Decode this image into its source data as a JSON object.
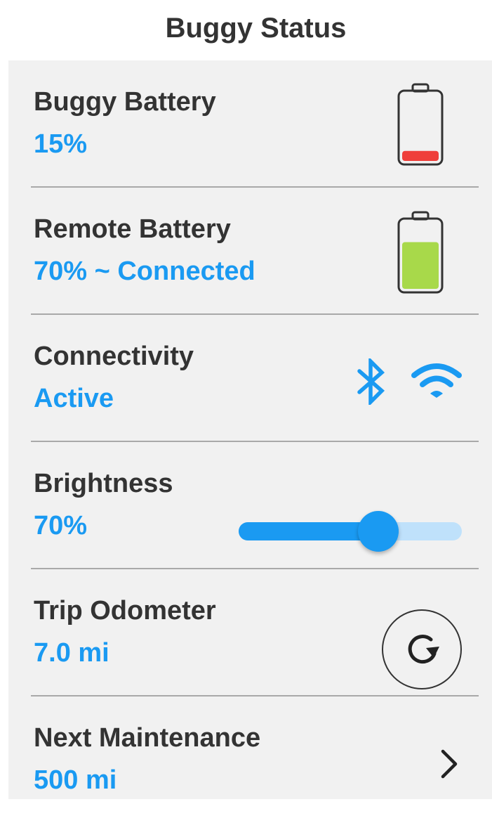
{
  "title": "Buggy Status",
  "colors": {
    "accent": "#1a9af2",
    "text": "#333333",
    "panel": "#f1f1f1",
    "battery_low": "#ef3e3a",
    "battery_good": "#a8d94a",
    "slider_track": "#bfe1fb"
  },
  "buggy_battery": {
    "label": "Buggy Battery",
    "value": "15%",
    "level": 0.15,
    "icon": "battery-low-icon"
  },
  "remote_battery": {
    "label": "Remote Battery",
    "value": "70% ~ Connected",
    "level": 0.7,
    "icon": "battery-icon"
  },
  "connectivity": {
    "label": "Connectivity",
    "value": "Active",
    "icons": [
      "bluetooth-icon",
      "wifi-icon"
    ]
  },
  "brightness": {
    "label": "Brightness",
    "value": "70%",
    "level": 0.7
  },
  "trip_odometer": {
    "label": "Trip Odometer",
    "value": "7.0 mi",
    "icon": "reset-icon"
  },
  "next_maintenance": {
    "label": "Next Maintenance",
    "value": "500 mi",
    "icon": "chevron-right-icon"
  }
}
